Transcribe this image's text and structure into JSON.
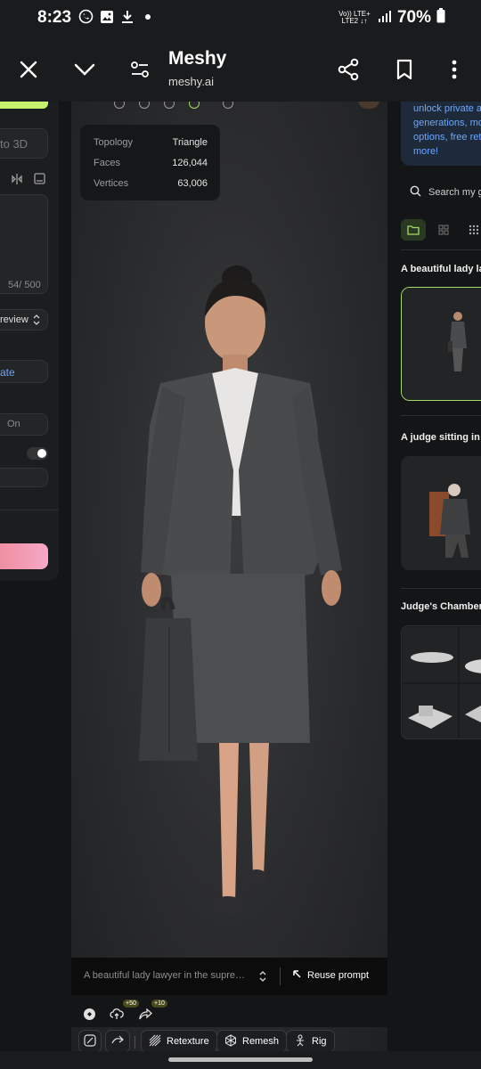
{
  "status_bar": {
    "time": "8:23",
    "network_top": "Vo)) LTE+",
    "network_bottom": "LTE2 ↓↑",
    "battery": "70%"
  },
  "browser": {
    "title": "Meshy",
    "url": "meshy.ai"
  },
  "left_panel": {
    "mode_text": "to 3D",
    "char_count": "54/ 500",
    "preview_label": "review",
    "generate_link": "ate",
    "on_label": "On"
  },
  "viewer": {
    "stats": [
      {
        "label": "Topology",
        "value": "Triangle"
      },
      {
        "label": "Faces",
        "value": "126,044"
      },
      {
        "label": "Vertices",
        "value": "63,006"
      }
    ]
  },
  "prompt_bar": {
    "prompt_text": "A beautiful lady lawyer in the suprem…",
    "reuse_label": "Reuse prompt"
  },
  "actions": {
    "upload_badge": "+50",
    "share_badge": "+10",
    "retexture_label": "Retexture",
    "remesh_label": "Remesh",
    "rig_label": "Rig"
  },
  "right_panel": {
    "promo_lines": [
      "unlock private a",
      "generations, mo",
      "options, free ret",
      "more!"
    ],
    "search_placeholder": "Search my g",
    "items": [
      {
        "label": "A beautiful lady law"
      },
      {
        "label": "A judge sitting in hi"
      },
      {
        "label": "Judge's Chambers"
      }
    ]
  },
  "colors": {
    "accent_green": "#c4f26d",
    "link_blue": "#6aa7ff",
    "pink_gradient_start": "#ef8a9c"
  }
}
